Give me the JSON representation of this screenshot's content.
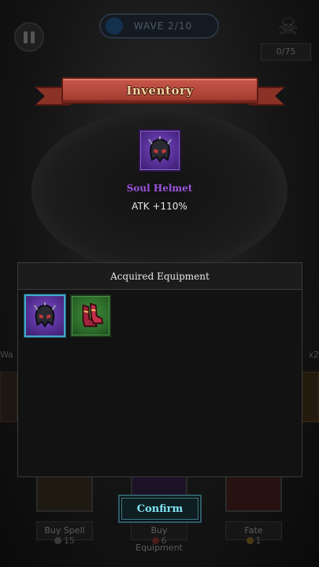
{
  "hud": {
    "wave_label": "WAVE 2/10",
    "kill_counter": "0/75",
    "side_left_label": "Wa",
    "side_right_label": "x2"
  },
  "shop": [
    {
      "label": "Buy Spell",
      "price": "15"
    },
    {
      "label": "Buy Equipment",
      "price": "6"
    },
    {
      "label": "Fate",
      "price": "1"
    }
  ],
  "inventory": {
    "title": "Inventory",
    "featured_item": {
      "name": "Soul Helmet",
      "stat": "ATK +110%",
      "icon": "helmet-icon"
    },
    "acquired_header": "Acquired Equipment",
    "acquired_items": [
      {
        "icon": "helmet-icon",
        "rarity": "purple",
        "selected": true
      },
      {
        "icon": "boots-icon",
        "rarity": "green",
        "selected": false
      }
    ],
    "confirm_label": "Confirm"
  },
  "colors": {
    "banner": "#b84a3c",
    "rarity_purple": "#6a3cb0",
    "rarity_green": "#357a32",
    "featured_name": "#9b54e0",
    "confirm_text": "#7fe3f2"
  }
}
